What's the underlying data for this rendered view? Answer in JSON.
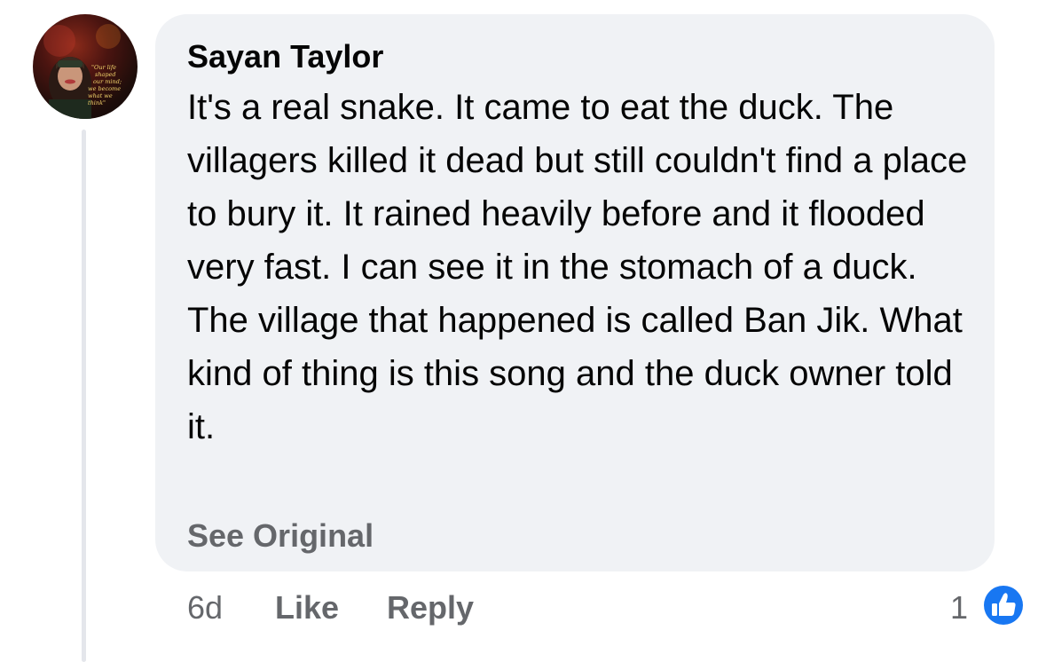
{
  "comment": {
    "author": "Sayan Taylor",
    "avatar_text": "\"Our life is shaped by our mind; we become what we think\"",
    "text": "It's a real snake. It came to eat the duck. The villagers killed it dead but still couldn't find a place to bury it. It rained heavily before and it flooded very fast. I can see it in the stomach of a duck. The village that happened is called Ban Jik. What kind of thing is this song and the duck owner told it.",
    "see_original": "See Original",
    "time": "6d",
    "like_label": "Like",
    "reply_label": "Reply",
    "reaction_count": "1",
    "reaction_icon": "thumbs-up-icon"
  },
  "colors": {
    "bubble_bg": "#f0f2f5",
    "text_primary": "#050505",
    "text_secondary": "#65676b",
    "like_blue": "#1877f2"
  }
}
